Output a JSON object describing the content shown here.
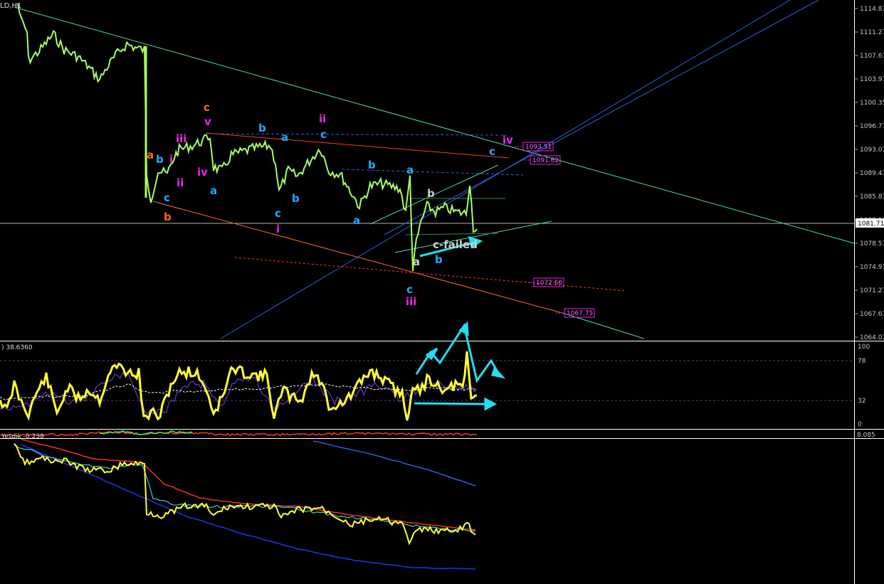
{
  "window": {
    "title_fragment": "LD,H1",
    "rsi_label": ") 38.6360",
    "lower_label": "Yesdik -0.238"
  },
  "price_axis": {
    "ticks": [
      "1114.87",
      "1111.27",
      "1107.67",
      "1103.97",
      "1100.35",
      "1096.77",
      "1093.07",
      "1089.47",
      "1085.87",
      "1082.17",
      "1078.57",
      "1074.97",
      "1071.27",
      "1067.67",
      "1064.07"
    ],
    "current_price": "1081.71"
  },
  "rsi_axis": {
    "ticks": [
      "100",
      "78",
      "32",
      "0"
    ]
  },
  "lower_axis": {
    "ticks": [
      "8.085"
    ]
  },
  "price_boxes": [
    {
      "name": "price-box-1093",
      "text": "1093.51"
    },
    {
      "name": "price-box-1091",
      "text": "1091.62"
    },
    {
      "name": "price-box-1072",
      "text": "1072.66"
    },
    {
      "name": "price-box-1067",
      "text": "1067.75"
    }
  ],
  "wave_labels": [
    {
      "text": "c",
      "color": "#ff6622"
    },
    {
      "text": "v",
      "color": "#ee22ee"
    },
    {
      "text": "iii",
      "color": "#ee22ee"
    },
    {
      "text": "a",
      "color": "#ff6622"
    },
    {
      "text": "b",
      "color": "#22aaff"
    },
    {
      "text": "i",
      "color": "#ee22ee"
    },
    {
      "text": "ii",
      "color": "#ee22ee"
    },
    {
      "text": "iv",
      "color": "#ee22ee"
    },
    {
      "text": "a",
      "color": "#22aaff"
    },
    {
      "text": "c",
      "color": "#22aaff"
    },
    {
      "text": "b",
      "color": "#ff6622"
    },
    {
      "text": "b",
      "color": "#22aaff"
    },
    {
      "text": "a",
      "color": "#22aaff"
    },
    {
      "text": "ii",
      "color": "#ee22ee"
    },
    {
      "text": "c",
      "color": "#22aaff"
    },
    {
      "text": "b",
      "color": "#22aaff"
    },
    {
      "text": "c",
      "color": "#22aaff"
    },
    {
      "text": "i",
      "color": "#ee22ee"
    },
    {
      "text": "b",
      "color": "#22aaff"
    },
    {
      "text": "a",
      "color": "#22aaff"
    },
    {
      "text": "a",
      "color": "#22aaff"
    },
    {
      "text": "b",
      "color": "#cccccc"
    },
    {
      "text": "a",
      "color": "#cccccc"
    },
    {
      "text": "c",
      "color": "#22aaff"
    },
    {
      "text": "iii",
      "color": "#ee22ee"
    },
    {
      "text": "b",
      "color": "#22aaff"
    },
    {
      "text": "c-failed",
      "color": "#cccccc"
    },
    {
      "text": "c",
      "color": "#22aaff"
    },
    {
      "text": "iv",
      "color": "#ee22ee"
    }
  ],
  "colors": {
    "price_line": "#a8ff60",
    "rsi_line": "#ffff33",
    "channel_blue": "#2f5fd8",
    "trend_teal": "#54d8a8",
    "red_line": "#ff3a1a",
    "orange_line": "#ff6a2a",
    "cyan_arrow": "#22ddee",
    "magenta": "#ee22ee"
  }
}
